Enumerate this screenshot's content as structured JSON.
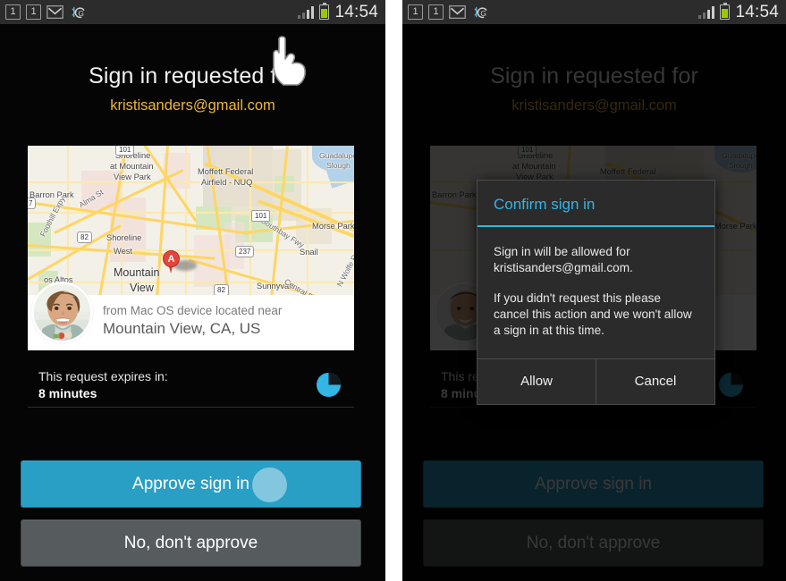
{
  "statusbar": {
    "icon1": "notification-badge-1-icon",
    "icon2": "notification-badge-1-icon",
    "icon3": "gmail-icon",
    "icon4": "bluetooth-sync-icon",
    "signal": "signal-bars-icon",
    "battery": "battery-icon",
    "time": "14:54"
  },
  "header": {
    "title": "Sign in requested for",
    "email": "kristisanders@gmail.com",
    "title_color": "#f1f1f1",
    "email_color": "#f0b832"
  },
  "map": {
    "marker_label": "A",
    "labels": [
      "Shoreline at Mountain View Park",
      "Moffett Federal Airfield - NUQ",
      "Guadalupe Slough",
      "Barron Park",
      "Alma St",
      "Shoreline West",
      "Mountain View",
      "Los Altos",
      "Foothill Expy",
      "Morse Park",
      "Southbay Fwy",
      "Snail",
      "Sunnyvale West",
      "Central Expy",
      "N Wolfe Rd"
    ],
    "shields": [
      "101",
      "82",
      "101",
      "237",
      "82"
    ],
    "device_line": "from Mac OS device located near",
    "location_line": "Mountain View, CA, US",
    "avatar": "user-avatar"
  },
  "expires": {
    "label": "This request expires in:",
    "value": "8 minutes",
    "timer_icon": "pie-timer-icon",
    "timer_color": "#33b5e5",
    "remaining_fraction": 0.75
  },
  "actions": {
    "approve_label": "Approve sign in",
    "deny_label": "No, don't approve",
    "approve_color": "#2a9fc6",
    "deny_color": "#565b5e",
    "tap_indicator": "touch-ripple",
    "cursor": "hand-pointer-icon"
  },
  "dialog": {
    "title": "Confirm sign in",
    "title_color": "#33b5e5",
    "body1": "Sign in will be allowed for kristisanders@gmail.com.",
    "body2": "If you didn't request this please cancel this action and we won't allow a sign in at this time.",
    "allow_label": "Allow",
    "cancel_label": "Cancel"
  }
}
